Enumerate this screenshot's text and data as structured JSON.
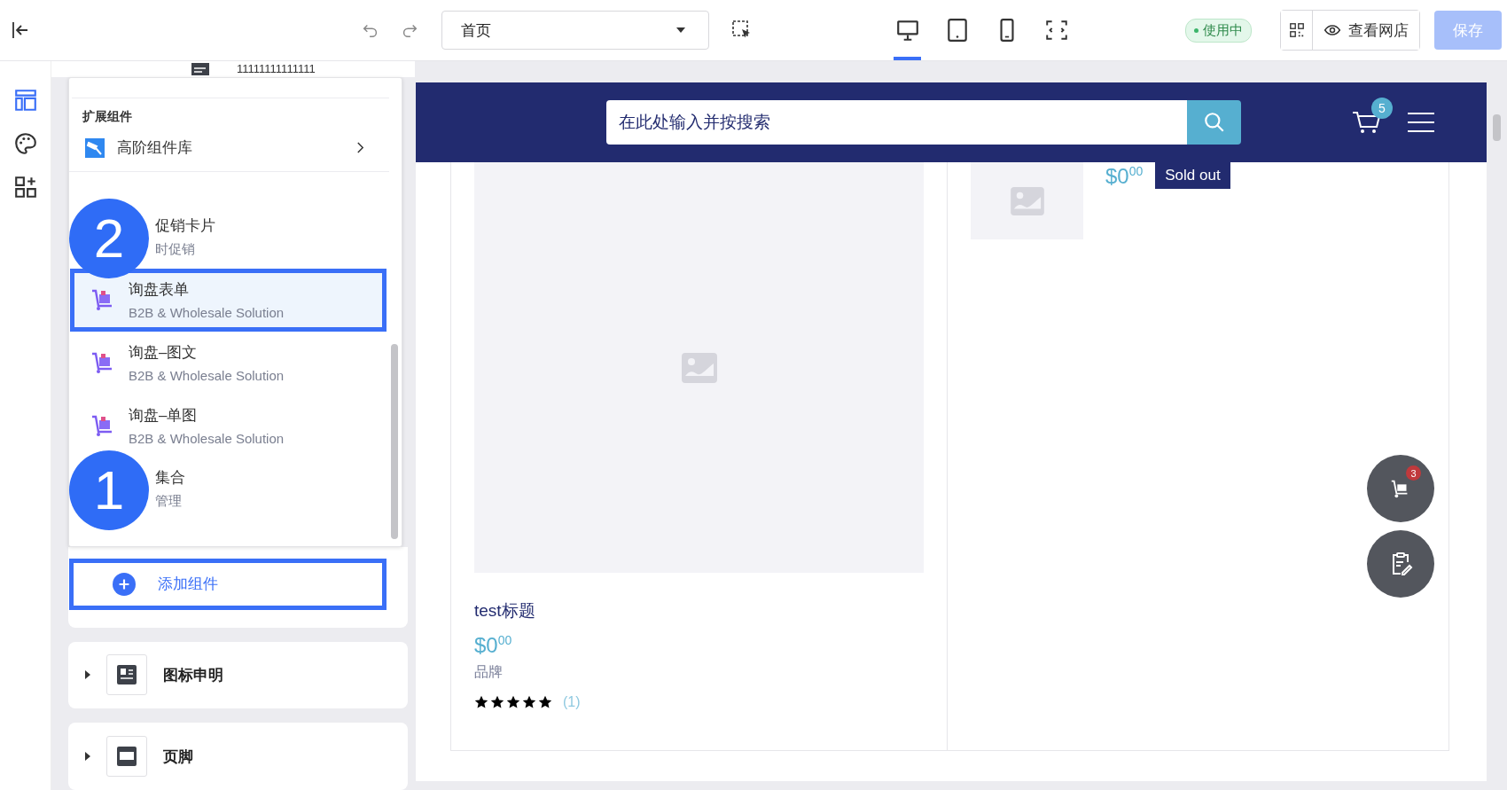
{
  "toolbar": {
    "page_select": {
      "value": "首页"
    },
    "devices": [
      {
        "kind": "desktop",
        "selected": true
      },
      {
        "kind": "tablet",
        "selected": false
      },
      {
        "kind": "phone",
        "selected": false
      },
      {
        "kind": "fit",
        "selected": false
      }
    ],
    "status": "使用中",
    "view_store": "查看网店",
    "save": {
      "label": "保存",
      "disabled": true
    }
  },
  "rail": [
    {
      "kind": "layout",
      "selected": true
    },
    {
      "kind": "theme",
      "selected": false
    },
    {
      "kind": "add",
      "selected": false
    }
  ],
  "panel": {
    "partial_row": "11111111111111",
    "popup": {
      "heading": "扩展组件",
      "library": "高阶组件库",
      "items": [
        {
          "title": "促销卡片",
          "subtitle": "时促销",
          "selected": false,
          "icon": false
        },
        {
          "title": "询盘表单",
          "subtitle": "B2B & Wholesale Solution",
          "selected": true,
          "icon": true
        },
        {
          "title": "询盘–图文",
          "subtitle": "B2B & Wholesale Solution",
          "selected": false,
          "icon": true
        },
        {
          "title": "询盘–单图",
          "subtitle": "B2B & Wholesale Solution",
          "selected": false,
          "icon": true
        },
        {
          "title": "集合",
          "subtitle": "管理",
          "selected": false,
          "icon": false
        }
      ],
      "steps": [
        {
          "label": "2"
        },
        {
          "label": "1"
        }
      ]
    },
    "add_button": "添加组件",
    "sections": [
      {
        "title": "图标申明",
        "kind": "legend"
      },
      {
        "title": "页脚",
        "kind": "footer"
      }
    ]
  },
  "preview": {
    "search_placeholder": "在此处输入并按搜索",
    "cart_count": "5",
    "product": {
      "title": "test标题",
      "price": "$0",
      "cents": "00",
      "brand": "品牌",
      "stars": 5,
      "reviews": "(1)"
    },
    "side_product": {
      "price": "$0",
      "cents": "00",
      "tag": "Sold out"
    },
    "inquiry_count": "3"
  }
}
